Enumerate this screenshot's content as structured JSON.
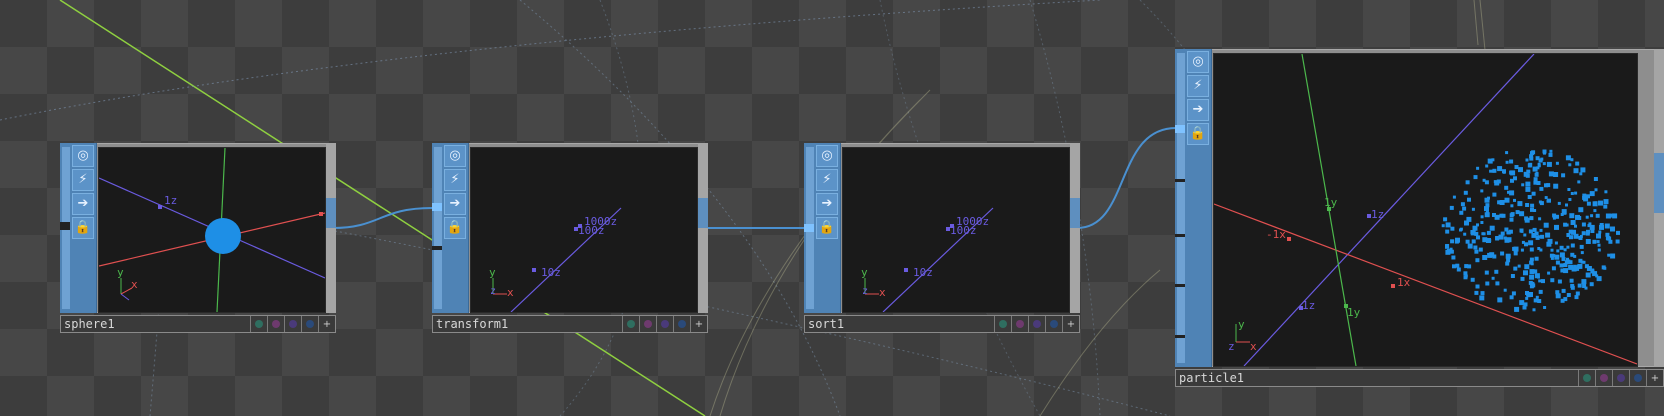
{
  "nodes": [
    {
      "name": "sphere1",
      "viewer": {
        "axis_labels": [
          "1z"
        ],
        "gizmo": {
          "y": "y",
          "x": "x"
        }
      }
    },
    {
      "name": "transform1",
      "viewer": {
        "axis_labels": [
          "1000z",
          "100z",
          "10z"
        ],
        "gizmo": {
          "y": "y",
          "z": "z",
          "x": "x"
        }
      }
    },
    {
      "name": "sort1",
      "viewer": {
        "axis_labels": [
          "1000z",
          "100z",
          "10z"
        ],
        "gizmo": {
          "y": "y",
          "z": "z",
          "x": "x"
        }
      }
    },
    {
      "name": "particle1",
      "viewer": {
        "axis_labels": [
          "1y",
          "1z",
          "-1x",
          "1x",
          "1z",
          "1y"
        ],
        "gizmo": {
          "y": "y",
          "z": "z",
          "x": "x"
        }
      }
    }
  ],
  "node_buttons": {
    "viewer_icon": "◎",
    "cook_icon": "⚡",
    "export_icon": "➔",
    "lock_icon": "🔒"
  },
  "flag_icons": {
    "bypass": "bypass-flag-icon",
    "lock": "lock-flag-icon",
    "display": "display-flag-icon",
    "render": "render-flag-icon",
    "add": "+"
  },
  "colors": {
    "operator_blue": "#4f83b5",
    "wire": "#4a90d0",
    "particle": "#1e8fe6",
    "axis_x": "#e05050",
    "axis_y": "#4cb84c",
    "axis_z": "#6a5be0",
    "green_wire": "#8fd040"
  }
}
